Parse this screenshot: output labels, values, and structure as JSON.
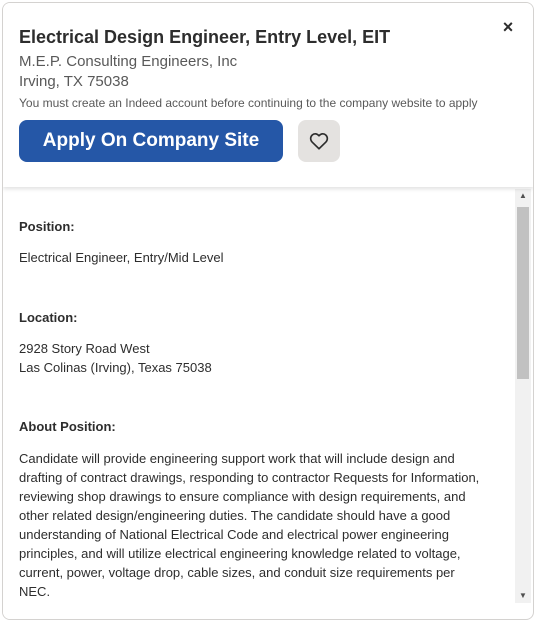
{
  "header": {
    "job_title": "Electrical Design Engineer, Entry Level, EIT",
    "company": "M.E.P. Consulting Engineers, Inc",
    "location": "Irving, TX 75038",
    "notice": "You must create an Indeed account before continuing to the company website to apply",
    "apply_label": "Apply On Company Site",
    "close_label": "×"
  },
  "body": {
    "sections": [
      {
        "label": "Position:",
        "text": "Electrical Engineer, Entry/Mid Level"
      },
      {
        "label": "Location:",
        "lines": [
          "2928 Story Road West",
          "Las Colinas (Irving), Texas 75038"
        ]
      },
      {
        "label": "About Position:",
        "text": "Candidate will provide engineering support work that will include design and drafting of contract drawings, responding to contractor Requests for Information, reviewing shop drawings to ensure compliance with design requirements, and other related design/engineering duties. The candidate should have a good understanding of National Electrical Code and electrical power engineering principles, and will utilize electrical engineering knowledge related to voltage, current, power, voltage drop, cable sizes, and conduit size requirements per NEC."
      }
    ]
  },
  "colors": {
    "apply_button": "#2557a7",
    "save_button": "#e4e2e0",
    "text": "#2d2d2d",
    "secondary_text": "#595959"
  },
  "icons": {
    "close": "close-icon",
    "save": "heart-icon",
    "scroll_up": "scroll-up-arrow-icon",
    "scroll_down": "scroll-down-arrow-icon"
  }
}
